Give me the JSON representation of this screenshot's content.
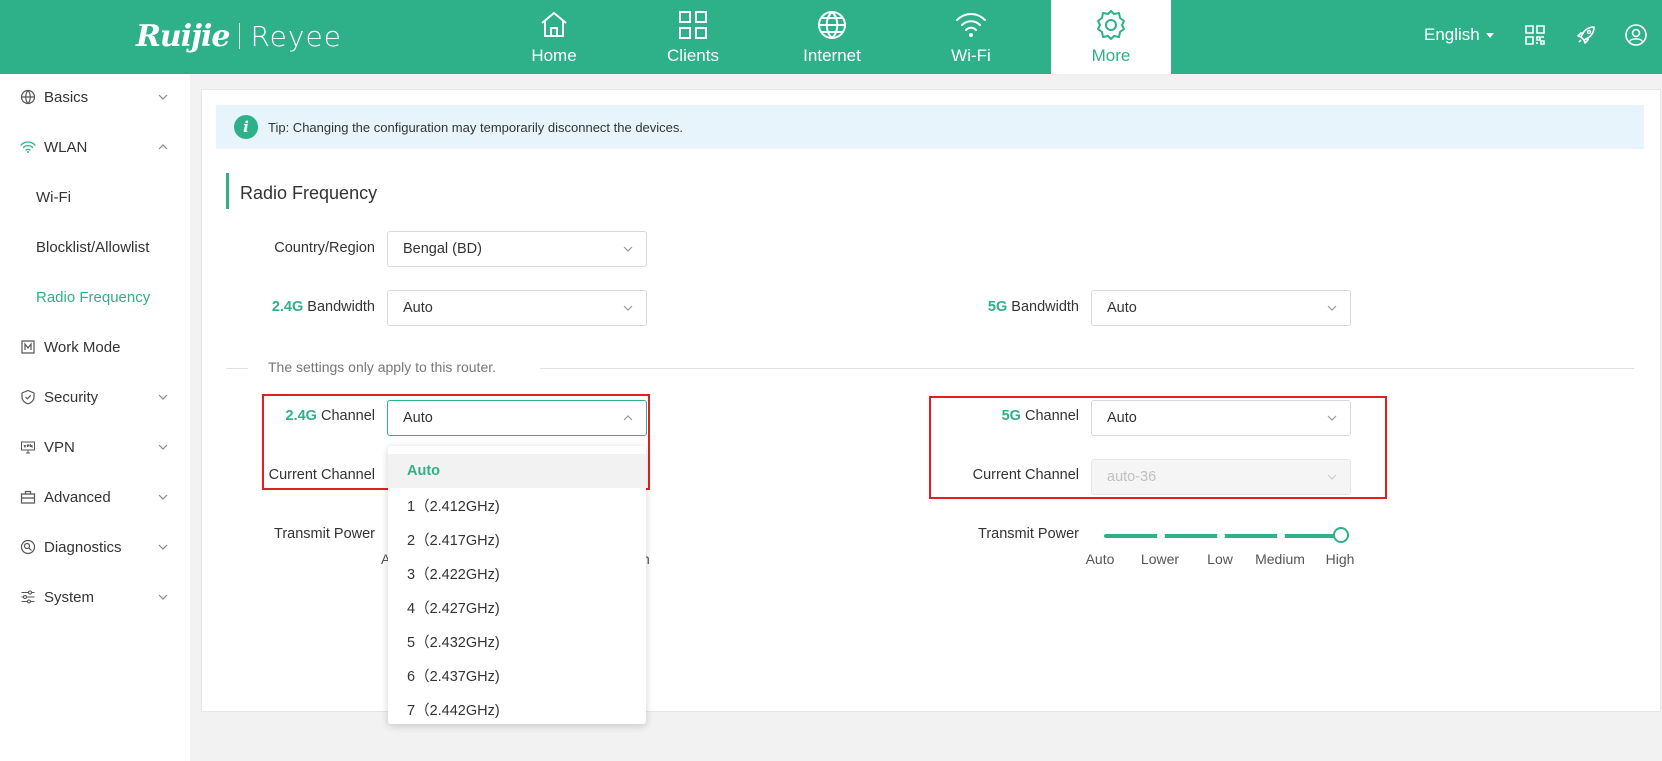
{
  "brand": {
    "left": "Ruijie",
    "right": "Reyee"
  },
  "nav": [
    {
      "label": "Home",
      "icon": "home-icon"
    },
    {
      "label": "Clients",
      "icon": "clients-grid-icon"
    },
    {
      "label": "Internet",
      "icon": "globe-icon"
    },
    {
      "label": "Wi-Fi",
      "icon": "wifi-icon"
    },
    {
      "label": "More",
      "icon": "gear-icon",
      "active": true
    }
  ],
  "header_right": {
    "language": "English"
  },
  "sidebar": {
    "items": [
      {
        "label": "Basics",
        "icon": "globe-icon"
      },
      {
        "label": "WLAN",
        "icon": "wifi-icon",
        "expanded": true
      },
      {
        "label": "Wi-Fi"
      },
      {
        "label": "Blocklist/Allowlist"
      },
      {
        "label": "Radio Frequency",
        "active": true
      },
      {
        "label": "Work Mode",
        "icon": "work-mode-icon"
      },
      {
        "label": "Security",
        "icon": "shield-icon"
      },
      {
        "label": "VPN",
        "icon": "vpn-icon"
      },
      {
        "label": "Advanced",
        "icon": "toolbox-icon"
      },
      {
        "label": "Diagnostics",
        "icon": "diagnostics-icon"
      },
      {
        "label": "System",
        "icon": "sliders-icon"
      }
    ]
  },
  "tip": "Tip: Changing the configuration may temporarily disconnect the devices.",
  "section_title": "Radio Frequency",
  "form": {
    "country_label": "Country/Region",
    "country_value": "Bengal (BD)",
    "bw24_band": "2.4G",
    "bw24_label": " Bandwidth",
    "bw24_value": "Auto",
    "bw5_band": "5G",
    "bw5_label": " Bandwidth",
    "bw5_value": "Auto",
    "divider": "The settings only apply to this router.",
    "ch24_band": "2.4G",
    "ch24_label": " Channel",
    "ch24_value": "Auto",
    "cur24_label": "Current Channel",
    "ch5_band": "5G",
    "ch5_label": " Channel",
    "ch5_value": "Auto",
    "cur5_label": "Current Channel",
    "cur5_value": "auto-36",
    "tp24_label": "Transmit Power",
    "tp24_peek_left": "A",
    "tp24_peek_right": "h",
    "tp5_label": "Transmit Power",
    "tp5_marks": [
      "Auto",
      "Lower",
      "Low",
      "Medium",
      "High"
    ],
    "tp5_level_index": 4
  },
  "dropdown_24_channel": {
    "options": [
      "Auto",
      "1（2.412GHz)",
      "2（2.417GHz)",
      "3（2.422GHz)",
      "4（2.427GHz)",
      "5（2.432GHz)",
      "6（2.437GHz)",
      "7（2.442GHz)"
    ],
    "selected_index": 0
  },
  "colors": {
    "brand": "#2eb188",
    "highlight_box": "#e02020"
  }
}
